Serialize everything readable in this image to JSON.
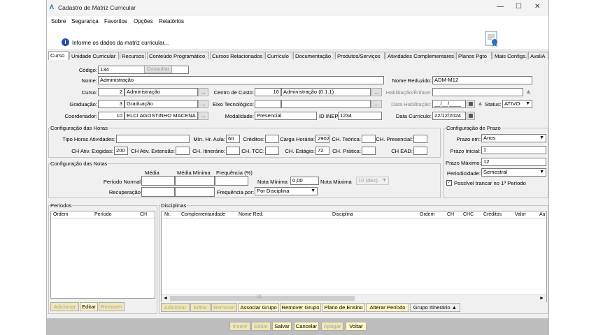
{
  "window": {
    "title": "Cadastro de Matriz Curricular",
    "logo_glyph": "Λ",
    "minimize": "—",
    "maximize": "☐",
    "close": "✕"
  },
  "menu": [
    "Sobre",
    "Segurança",
    "Favoritos",
    "Opções",
    "Relatórios"
  ],
  "info": {
    "icon": "i",
    "text": "Informe os dados da matriz curricular..."
  },
  "tabs": [
    "Curso",
    "Unidade Curricular",
    "Recursos",
    "Conteúdo Programático",
    "Cursos Relacionados",
    "Currículo",
    "Documentação",
    "Produtos/Serviços",
    "Atividades Complementares",
    "Planos Pgto",
    "Mais Configs.",
    "AvaliA"
  ],
  "form": {
    "codigo_label": "Código:",
    "codigo": "134",
    "consultar": "Consultar",
    "nome_label": "Nome:",
    "nome": "Administração",
    "nome_reduzido_label": "Nome Reduzido:",
    "nome_reduzido": "ADM-M12",
    "curso_label": "Curso:",
    "curso_cod": "2",
    "curso": "Administração",
    "centro_label": "Centro de Custo:",
    "centro_cod": "16",
    "centro": "Administração (0.1.1)",
    "habilitacao_label": "Habilitação/Ênfase:",
    "graduacao_label": "Graduação:",
    "graduacao_cod": "3",
    "graduacao": "Graduação",
    "eixo_label": "Eixo Tecnológico:",
    "data_hab_label": "Data Habilitação:",
    "data_hab": "__/__/____",
    "status_label": "Status:",
    "status": "ATIVO",
    "coordenador_label": "Coordenador:",
    "coordenador_cod": "10",
    "coordenador": "ELCI AGOSTINHO MACENA",
    "modalidade_label": "Modalidade:",
    "modalidade": "Presencial",
    "idinep_label": "ID INEP:",
    "idinep": "1234",
    "data_curr_label": "Data Currículo:",
    "data_curr": "22/12/2024",
    "ellipsis": "...",
    "cal_icon": "▦",
    "warn_icon": "▲",
    "dropdown_arrow": "▼"
  },
  "horas": {
    "title": "Configuração das Horas",
    "tipo_label": "Tipo Horas Atividades:",
    "min_label": "Mín. Hr. Aula:",
    "min": "60",
    "creditos_label": "Créditos:",
    "carga_label": "Carga Horária:",
    "carga": "2902",
    "teorica_label": "CH. Teórica:",
    "presencial_label": "CH. Presencial:",
    "exigidas_label": "CH Ativ. Exigidas:",
    "exigidas": "200",
    "extensao_label": "CH Ativ. Extensão:",
    "itinerario_label": "CH. Itinerário:",
    "tcc_label": "CH. TCC:",
    "estagio_label": "CH. Estágio:",
    "estagio": "72",
    "pratica_label": "CH. Prática:",
    "ead_label": "CH EAD:"
  },
  "notas": {
    "title": "Configuração das Notas",
    "media_hdr": "Média",
    "media_min_hdr": "Média Mínima",
    "freq_hdr": "Frequência (%)",
    "periodo_label": "Período Normal",
    "recuperacao_label": "Recuperação",
    "nota_min_label": "Nota Mínima",
    "nota_min": "0,00",
    "nota_max_label": "Nota Máxima",
    "nota_max": "10 (dez)",
    "freq_por_label": "Frequência por:",
    "freq_por": "Por Disciplina"
  },
  "prazo": {
    "title": "Configuração de Prazo",
    "em_label": "Prazo em:",
    "em": "Anos",
    "inicial_label": "Prazo Inicial:",
    "inicial": "1",
    "maximo_label": "Prazo Máximo:",
    "maximo": "12",
    "periodicidade_label": "Periodicidade:",
    "periodicidade": "Semestral",
    "trancar_label": "Possível trancar no 1º Período",
    "trancar_check": "✓"
  },
  "periodos": {
    "title": "Períodos",
    "cols": [
      "Ordem",
      "Período",
      "CH"
    ],
    "buttons": [
      "Adicionar",
      "Editar",
      "Remover"
    ]
  },
  "disciplinas": {
    "title": "Disciplinas",
    "cols": [
      "Nr.",
      "Complementaridade",
      "Nome Red.",
      "Disciplina",
      "Ordem",
      "CH",
      "CHC",
      "Créditos",
      "Valor",
      "Au"
    ],
    "buttons": [
      "Adicionar",
      "Editar",
      "Remover",
      "Associar Grupo",
      "Remover Grupo",
      "Plano de Ensino",
      "Alterar Período"
    ],
    "grupo_itinerario": "Grupo Itinerário",
    "grupo_arrow": "▲",
    "scroll_left": "◄",
    "scroll_right": "►",
    "scroll_grip": "⁞⁞⁞"
  },
  "bottom": [
    "Inserir",
    "Editar",
    "Salvar",
    "Cancelar",
    "Apagar",
    "Voltar"
  ]
}
